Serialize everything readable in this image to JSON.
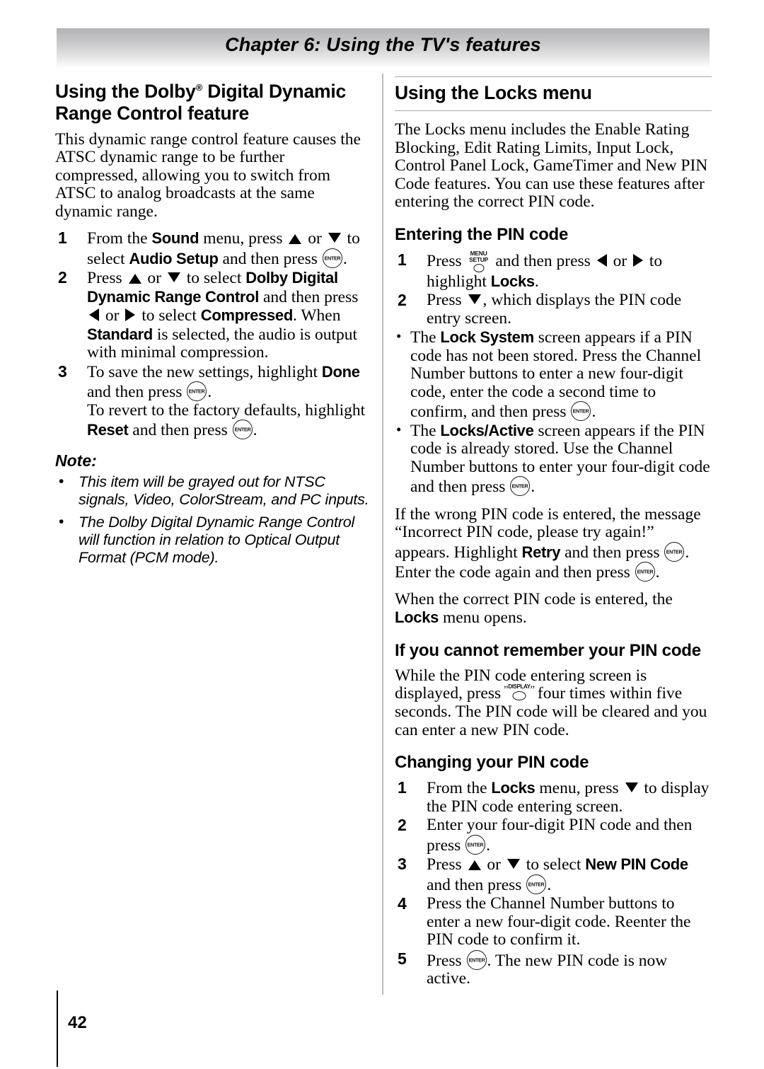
{
  "chapter": {
    "header": "Chapter 6: Using the TV's features"
  },
  "left_column": {
    "heading_part1": "Using the Dolby",
    "heading_reg": "®",
    "heading_part2": " Digital Dynamic Range Control feature",
    "intro": "This dynamic range control feature causes the ATSC dynamic range to be further compressed, allowing you to switch from ATSC to analog broadcasts at the same dynamic range.",
    "steps": [
      {
        "num": "1",
        "t1": "From the ",
        "b1": "Sound",
        "t2": " menu, press ",
        "icon1": "arrow-up",
        "t3": " or ",
        "icon2": "arrow-down",
        "t4": " to select ",
        "b2": "Audio Setup",
        "t5": " and then press ",
        "icon3": "enter-button",
        "t6": "."
      },
      {
        "num": "2",
        "t1": "Press ",
        "icon1": "arrow-up",
        "t2": " or ",
        "icon2": "arrow-down",
        "t3": " to select ",
        "b1": "Dolby Digital Dynamic Range Control",
        "t4": " and then press ",
        "icon3": "arrow-left",
        "t5": " or ",
        "icon4": "arrow-right",
        "t6": " to select ",
        "b2": "Compressed",
        "t7": ". When ",
        "b3": "Standard",
        "t8": " is selected, the audio is output with minimal compression."
      },
      {
        "num": "3",
        "t1": "To save the new settings, highlight ",
        "b1": "Done",
        "t2": " and then press ",
        "icon1": "enter-button",
        "t3": ".",
        "sub_t1": "To revert to the factory defaults, highlight ",
        "sub_b1": "Reset",
        "sub_t2": " and then press ",
        "sub_icon1": "enter-button",
        "sub_t3": "."
      }
    ],
    "note_label": "Note:",
    "notes": [
      "This item will be grayed out for NTSC signals, Video, ColorStream, and PC inputs.",
      "The Dolby Digital Dynamic Range Control will function in relation to Optical Output Format (PCM mode)."
    ]
  },
  "right_column": {
    "heading": "Using the Locks menu",
    "intro": "The Locks menu includes the Enable Rating Blocking, Edit Rating Limits, Input Lock, Control Panel Lock, GameTimer and New PIN Code features. You can use these features after entering the correct PIN code.",
    "sub1_heading": "Entering the PIN code",
    "sub1_steps": [
      {
        "num": "1",
        "t1": "Press ",
        "icon1": "menu-setup-button",
        "t2": " and then press ",
        "icon2": "arrow-left",
        "t3": " or ",
        "icon3": "arrow-right",
        "t4": " to highlight ",
        "b1": "Locks",
        "t5": "."
      },
      {
        "num": "2",
        "t1": "Press ",
        "icon1": "arrow-down",
        "t2": ", which displays the PIN code entry screen."
      }
    ],
    "sub1_bullets": [
      {
        "t1": "The ",
        "b1": "Lock System",
        "t2": " screen appears if a PIN code has not been stored. Press the Channel Number buttons to enter a new four-digit code, enter the code a second time to confirm, and then press ",
        "icon1": "enter-button",
        "t3": "."
      },
      {
        "t1": "The ",
        "b1": "Locks/Active",
        "t2": " screen appears if the PIN code is already stored. Use the Channel Number buttons to enter your four-digit code and then press ",
        "icon1": "enter-button",
        "t3": "."
      }
    ],
    "para_wrong_1": "If the wrong PIN code is entered, the message “Incorrect PIN code, please try again!” appears. Highlight ",
    "para_wrong_b": "Retry",
    "para_wrong_2": " and then press ",
    "para_wrong_icon1": "enter-button",
    "para_wrong_3": ". Enter the code again and then press ",
    "para_wrong_icon2": "enter-button",
    "para_wrong_4": ".",
    "para_correct_1": "When the correct PIN code is entered, the ",
    "para_correct_b": "Locks",
    "para_correct_2": " menu opens.",
    "sub2_heading": "If you cannot remember your PIN code",
    "sub2_para_1": "While the PIN code entering screen is displayed, press ",
    "sub2_icon": "display-button",
    "sub2_para_2": " four times within five seconds. The PIN code will be cleared and you can enter a new PIN code.",
    "sub3_heading": "Changing your PIN code",
    "sub3_steps": [
      {
        "num": "1",
        "t1": "From the ",
        "b1": "Locks",
        "t2": " menu, press ",
        "icon1": "arrow-down",
        "t3": " to display the PIN code entering screen."
      },
      {
        "num": "2",
        "t1": "Enter your four-digit PIN code and then press ",
        "icon1": "enter-button",
        "t2": "."
      },
      {
        "num": "3",
        "t1": "Press ",
        "icon1": "arrow-up",
        "t2": " or ",
        "icon2": "arrow-down",
        "t3": " to select ",
        "b1": "New PIN Code",
        "t4": " and then press ",
        "icon3": "enter-button",
        "t5": "."
      },
      {
        "num": "4",
        "t1": "Press the Channel Number buttons to enter a new four-digit code. Reenter the PIN code to confirm it."
      },
      {
        "num": "5",
        "t1": "Press ",
        "icon1": "enter-button",
        "t2": ". The new PIN code is now active."
      }
    ]
  },
  "icons": {
    "enter_label": "ENTER",
    "menu_label": "MENU",
    "setup_label": "SETUP",
    "display_label": "DISPLAY",
    "bullet_char": "•"
  },
  "footer": {
    "page_number": "42"
  }
}
